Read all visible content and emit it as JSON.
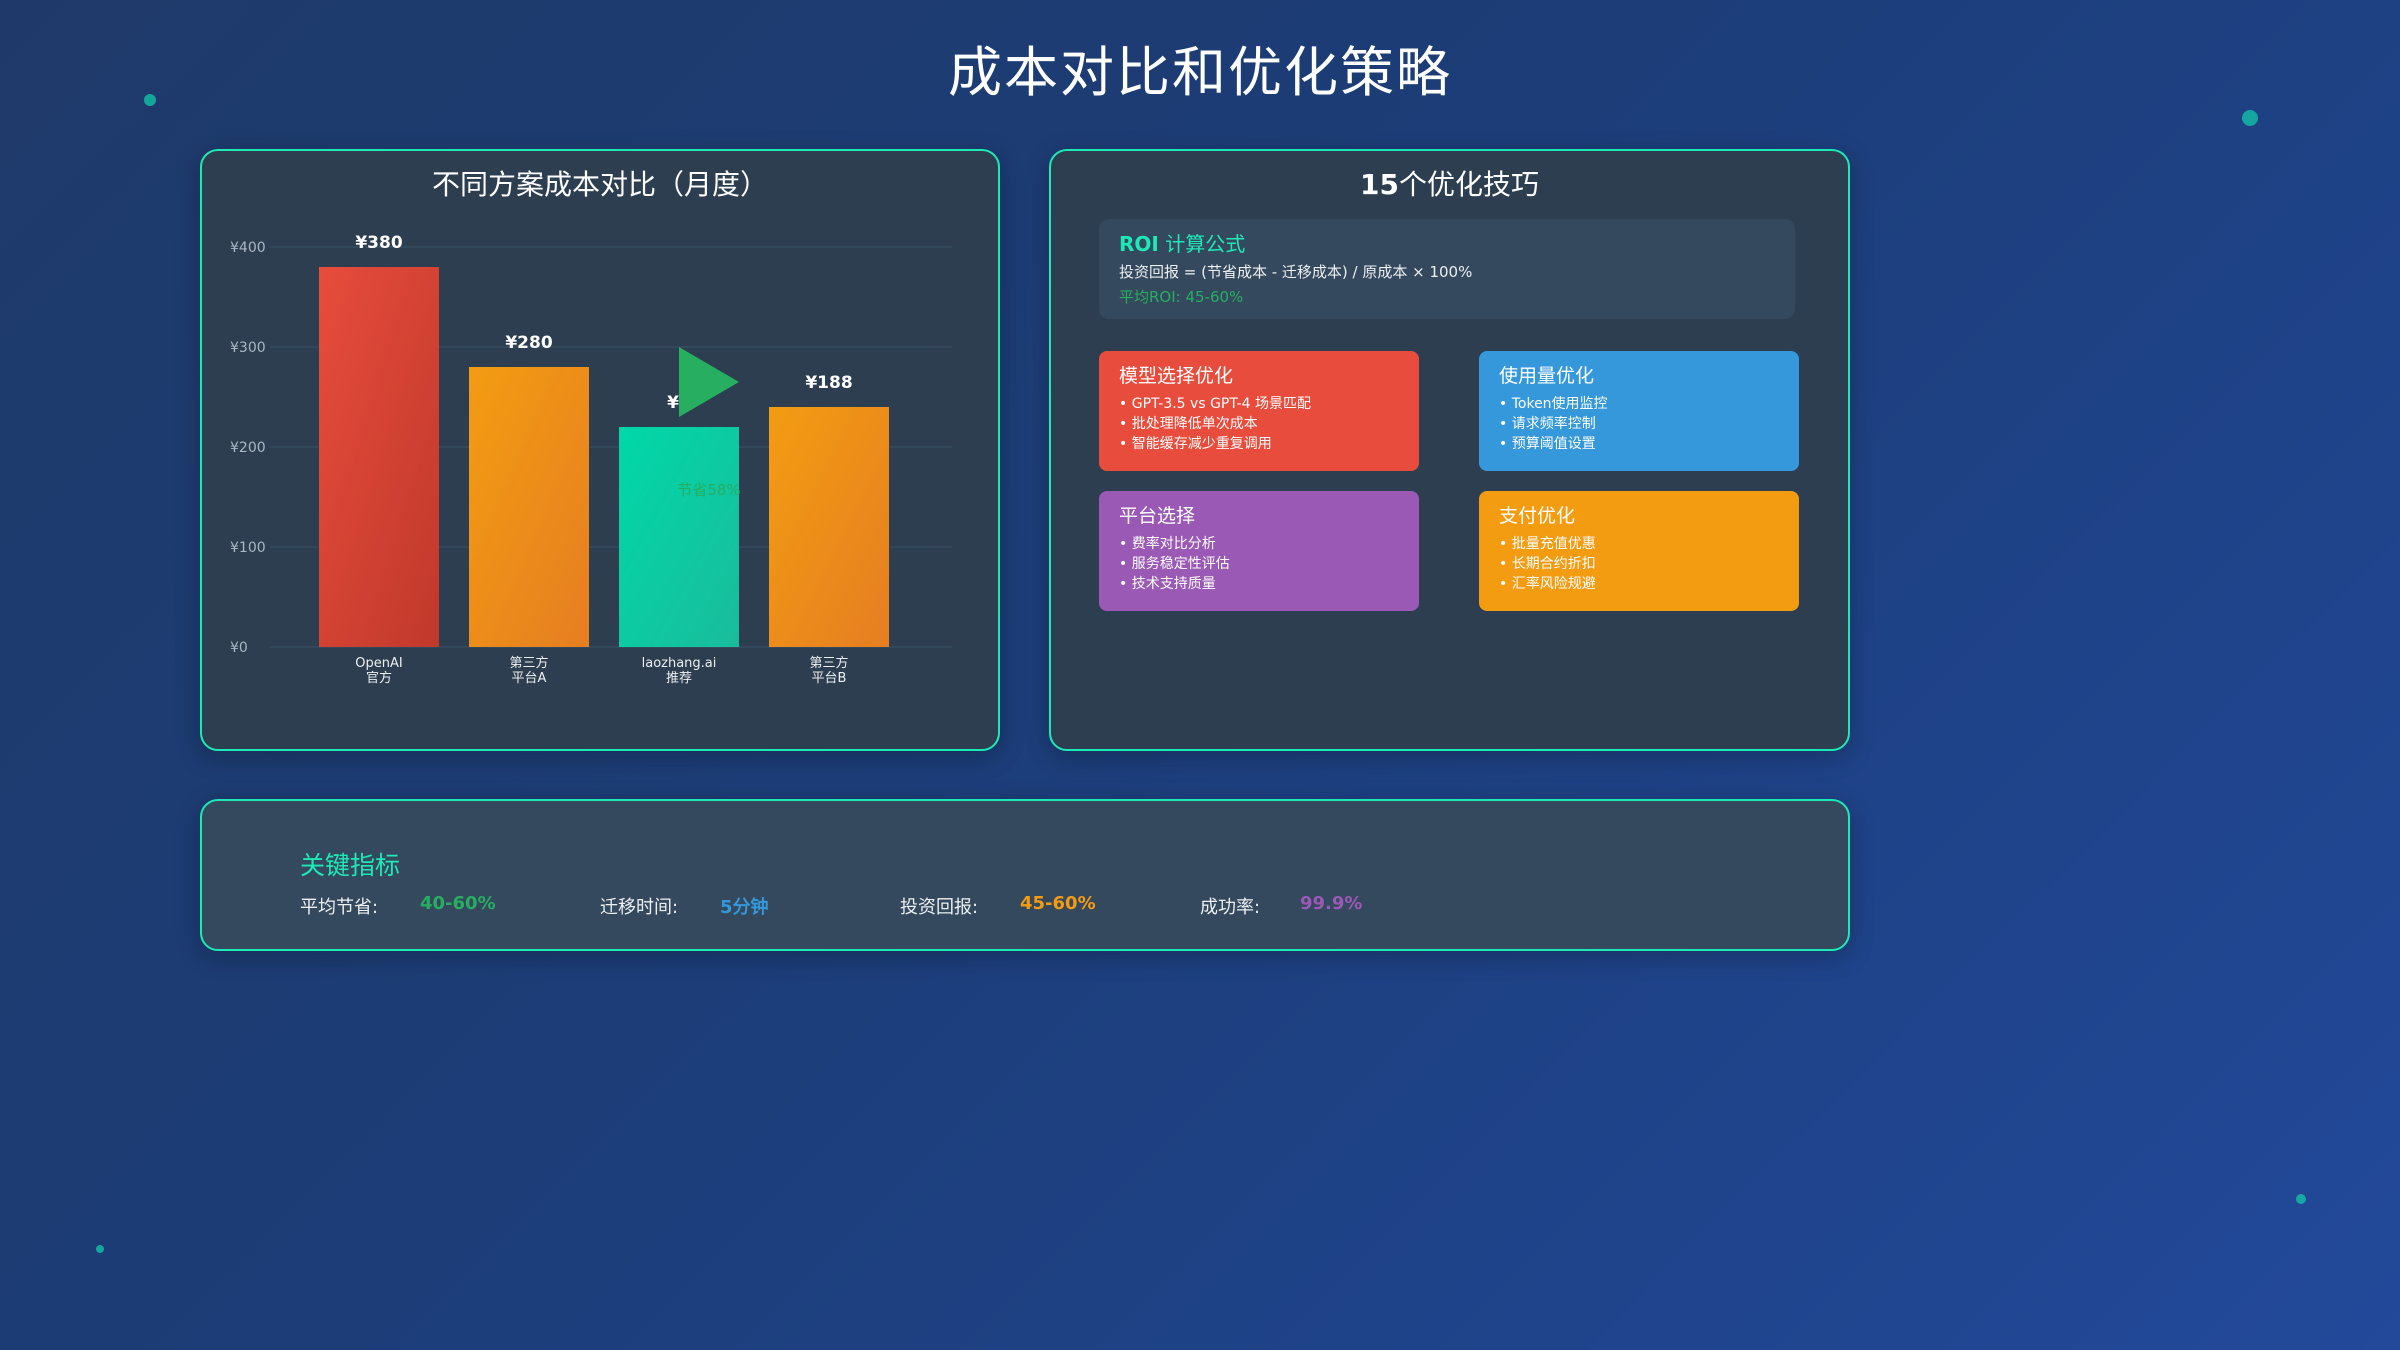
{
  "page": {
    "title": "成本对比和优化策略"
  },
  "chart_panel": {
    "title": "不同方案成本对比（月度）"
  },
  "chart_data": {
    "type": "bar",
    "title": "不同方案成本对比（月度）",
    "categories": [
      [
        "OpenAI",
        "官方"
      ],
      [
        "第三方",
        "平台A"
      ],
      [
        "laozhang.ai",
        "推荐"
      ],
      [
        "第三方",
        "平台B"
      ]
    ],
    "values": [
      380,
      280,
      220,
      240
    ],
    "value_labels": [
      "¥380",
      "¥280",
      "¥1",
      "¥188"
    ],
    "bar_colors": [
      [
        "#e74c3c",
        "#c0392b"
      ],
      [
        "#f39c12",
        "#e67e22"
      ],
      [
        "#00d8a8",
        "#1abc9c"
      ],
      [
        "#f39c12",
        "#e67e22"
      ]
    ],
    "y_ticks": [
      0,
      100,
      200,
      300,
      400
    ],
    "y_tick_labels": [
      "¥0",
      "¥100",
      "¥200",
      "¥300",
      "¥400"
    ],
    "ylim": [
      0,
      400
    ],
    "grid": true,
    "annotation": {
      "text": "节省58%",
      "bar_index": 2,
      "color": "#27ae60",
      "icon": "play-triangle-icon"
    }
  },
  "tips_panel": {
    "title_number": "15",
    "title_text": "个优化技巧",
    "roi": {
      "title_bold": "ROI",
      "title_rest": " 计算公式",
      "formula": "投资回报 = (节省成本 - 迁移成本) / 原成本 × 100%",
      "average": "平均ROI: 45-60%"
    },
    "cards": [
      {
        "title": "模型选择优化",
        "color": "#e74c3c",
        "items": [
          "GPT-3.5 vs GPT-4 场景匹配",
          "批处理降低单次成本",
          "智能缓存减少重复调用"
        ]
      },
      {
        "title": "使用量优化",
        "color": "#3498db",
        "items": [
          "Token使用监控",
          "请求频率控制",
          "预算阈值设置"
        ]
      },
      {
        "title": "平台选择",
        "color": "#9b59b6",
        "items": [
          "费率对比分析",
          "服务稳定性评估",
          "技术支持质量"
        ]
      },
      {
        "title": "支付优化",
        "color": "#f39c12",
        "items": [
          "批量充值优惠",
          "长期合约折扣",
          "汇率风险规避"
        ]
      }
    ]
  },
  "metrics": {
    "title": "关键指标",
    "items": [
      {
        "label": "平均节省:",
        "value": "40-60%",
        "color": "#27ae60"
      },
      {
        "label": "迁移时间:",
        "value": "5分钟",
        "color": "#3498db"
      },
      {
        "label": "投资回报:",
        "value": "45-60%",
        "color": "#f39c12"
      },
      {
        "label": "成功率:",
        "value": "99.9%",
        "color": "#9b59b6"
      }
    ]
  },
  "colors": {
    "accent": "#1de9b6",
    "panel_bg": "#2c3e50",
    "page_bg": "#1e3c72"
  }
}
